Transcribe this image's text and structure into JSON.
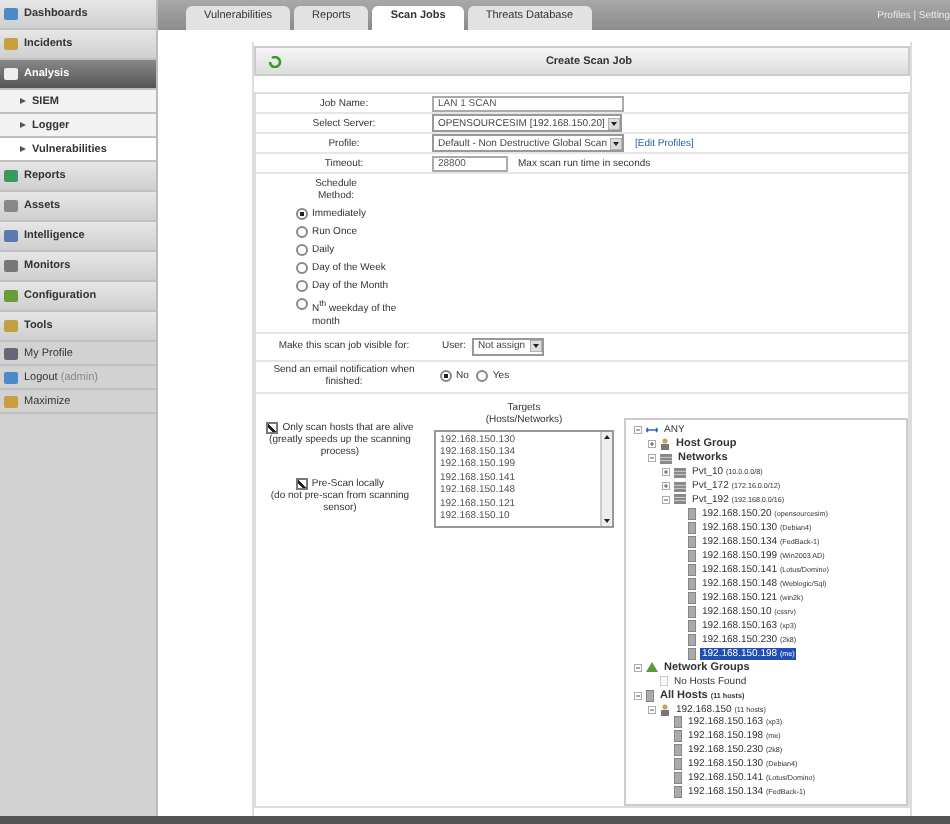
{
  "sidebar": {
    "items": [
      {
        "label": "Dashboards",
        "kind": "section",
        "selected": false
      },
      {
        "label": "Incidents",
        "kind": "section",
        "selected": false
      },
      {
        "label": "Analysis",
        "kind": "section",
        "selected": true
      },
      {
        "label": "SIEM",
        "kind": "sub",
        "selected": false
      },
      {
        "label": "Logger",
        "kind": "sub",
        "selected": false
      },
      {
        "label": "Vulnerabilities",
        "kind": "sub",
        "selected": true
      },
      {
        "label": "Reports",
        "kind": "section",
        "selected": false
      },
      {
        "label": "Assets",
        "kind": "section",
        "selected": false
      },
      {
        "label": "Intelligence",
        "kind": "section",
        "selected": false
      },
      {
        "label": "Monitors",
        "kind": "section",
        "selected": false
      },
      {
        "label": "Configuration",
        "kind": "section",
        "selected": false
      },
      {
        "label": "Tools",
        "kind": "section",
        "selected": false
      },
      {
        "label": "My Profile",
        "kind": "link",
        "selected": false
      },
      {
        "label": "Logout",
        "note": "(admin)",
        "kind": "link",
        "selected": false
      },
      {
        "label": "Maximize",
        "kind": "link",
        "selected": false
      }
    ]
  },
  "tabs": [
    {
      "label": "Vulnerabilities",
      "selected": false
    },
    {
      "label": "Reports",
      "selected": false
    },
    {
      "label": "Scan Jobs",
      "selected": true
    },
    {
      "label": "Threats Database",
      "selected": false
    }
  ],
  "top_links": "Profiles | Setting",
  "panel_title": "Create Scan Job",
  "fields": [
    {
      "label": "Job Name:",
      "kind": "input",
      "value": "LAN 1 SCAN"
    },
    {
      "label": "Select Server:",
      "kind": "select",
      "value": "OPENSOURCESIM [192.168.150.20]"
    },
    {
      "label": "Profile:",
      "kind": "select",
      "value": "Default - Non Destructive Global Scan",
      "link": "[Edit Profiles]"
    },
    {
      "label": "Timeout:",
      "kind": "input",
      "value": "28800",
      "hint": "Max scan run time in seconds"
    }
  ],
  "schedule": {
    "label": "Schedule Method:",
    "options": [
      {
        "label": "Immediately",
        "selected": true
      },
      {
        "label": "Run Once",
        "selected": false
      },
      {
        "label": "Daily",
        "selected": false
      },
      {
        "label": "Day of the Week",
        "selected": false
      },
      {
        "label": "Day of the Month",
        "selected": false
      },
      {
        "label": "N$^{th}$ weekday of the month",
        "selected": false
      }
    ]
  },
  "visibility": {
    "label": "Make this scan job visible for:",
    "user_label": "User:",
    "value": "Not assign"
  },
  "email": {
    "label": "Send an email notification when finished:",
    "options": [
      {
        "label": "No",
        "selected": true
      },
      {
        "label": "Yes",
        "selected": false
      }
    ]
  },
  "options": [
    {
      "label": "Only scan hosts that are alive",
      "note": "(greatly speeds up the scanning process)",
      "checked": true
    },
    {
      "label": "Pre-Scan locally",
      "note": "(do not pre-scan from scanning sensor)",
      "checked": true
    }
  ],
  "targets": {
    "title": "Targets",
    "subtitle": "(Hosts/Networks)",
    "items": [
      "192.168.150.130",
      "192.168.150.134",
      "192.168.150.199",
      "192.168.150.141",
      "192.168.150.148",
      "192.168.150.121",
      "192.168.150.10"
    ]
  },
  "tree": [
    {
      "label": "ANY",
      "kind": "any",
      "expanded": true,
      "selected": false,
      "children": [
        {
          "label": "Host Group",
          "kind": "group",
          "expanded": false,
          "selected": false,
          "bold": true
        },
        {
          "label": "Networks",
          "kind": "network",
          "expanded": true,
          "selected": false,
          "bold": true,
          "children": [
            {
              "label": "Pvt_10",
              "note": "(10.0.0.0/8)",
              "kind": "network",
              "expanded": false,
              "selected": false
            },
            {
              "label": "Pvt_172",
              "note": "(172.16.0.0/12)",
              "kind": "network",
              "expanded": false,
              "selected": false
            },
            {
              "label": "Pvt_192",
              "note": "(192.168.0.0/16)",
              "kind": "network",
              "expanded": true,
              "selected": false,
              "children": [
                {
                  "label": "192.168.150.20",
                  "note": "(opensourcesim)",
                  "kind": "host",
                  "selected": false
                },
                {
                  "label": "192.168.150.130",
                  "note": "(Debian4)",
                  "kind": "host",
                  "selected": false
                },
                {
                  "label": "192.168.150.134",
                  "note": "(FedBack-1)",
                  "kind": "host",
                  "selected": false
                },
                {
                  "label": "192.168.150.199",
                  "note": "(Win2003 AD)",
                  "kind": "host",
                  "selected": false
                },
                {
                  "label": "192.168.150.141",
                  "note": "(Lotus/Domino)",
                  "kind": "host",
                  "selected": false
                },
                {
                  "label": "192.168.150.148",
                  "note": "(Weblogic/Sql)",
                  "kind": "host",
                  "selected": false
                },
                {
                  "label": "192.168.150.121",
                  "note": "(win2k)",
                  "kind": "host",
                  "selected": false
                },
                {
                  "label": "192.168.150.10",
                  "note": "(cssrv)",
                  "kind": "host",
                  "selected": false
                },
                {
                  "label": "192.168.150.163",
                  "note": "(xp3)",
                  "kind": "host",
                  "selected": false
                },
                {
                  "label": "192.168.150.230",
                  "note": "(2k8)",
                  "kind": "host",
                  "selected": false
                },
                {
                  "label": "192.168.150.198",
                  "note": "(me)",
                  "kind": "host",
                  "selected": true
                }
              ]
            }
          ]
        }
      ]
    },
    {
      "label": "Network Groups",
      "kind": "netgroup",
      "expanded": true,
      "selected": false,
      "bold": true,
      "children": [
        {
          "label": "No Hosts Found",
          "kind": "empty",
          "selected": false
        }
      ]
    },
    {
      "label": "All Hosts",
      "note": "(11 hosts)",
      "kind": "host",
      "expanded": true,
      "selected": false,
      "bold": true,
      "children": [
        {
          "label": "192.168.150",
          "note": "(11 hosts)",
          "kind": "group",
          "expanded": true,
          "selected": false,
          "children": [
            {
              "label": "192.168.150.163",
              "note": "(xp3)",
              "kind": "host",
              "selected": false
            },
            {
              "label": "192.168.150.198",
              "note": "(me)",
              "kind": "host",
              "selected": false
            },
            {
              "label": "192.168.150.230",
              "note": "(2k8)",
              "kind": "host",
              "selected": false
            },
            {
              "label": "192.168.150.130",
              "note": "(Debian4)",
              "kind": "host",
              "selected": false
            },
            {
              "label": "192.168.150.141",
              "note": "(Lotus/Domino)",
              "kind": "host",
              "selected": false
            },
            {
              "label": "192.168.150.134",
              "note": "(FedBack-1)",
              "kind": "host",
              "selected": false
            }
          ]
        }
      ]
    }
  ]
}
